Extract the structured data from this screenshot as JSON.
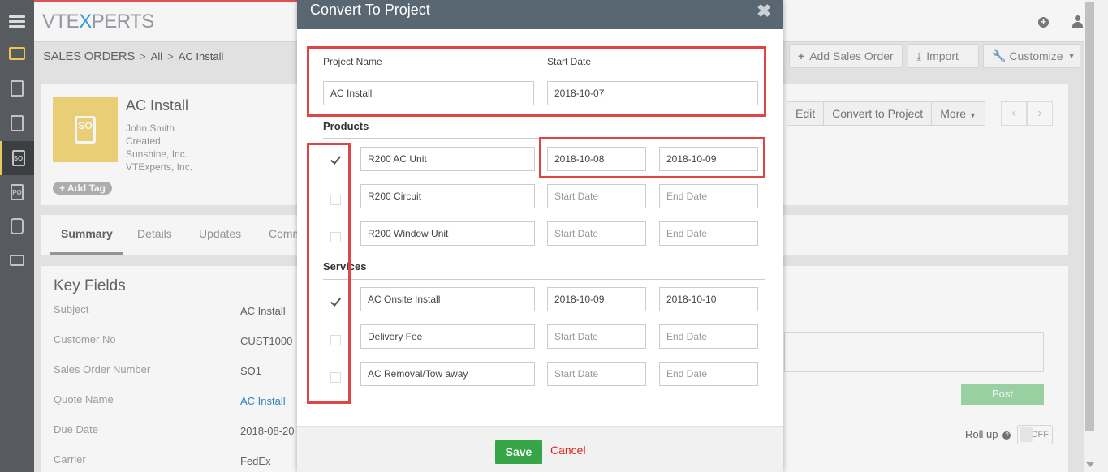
{
  "app": {
    "logo_prefix": "VTE",
    "logo_x": "X",
    "logo_suffix": "PERTS"
  },
  "header_icons": [
    "plus-circle-icon",
    "user-icon"
  ],
  "sidebar": {
    "items": [
      {
        "name": "menu",
        "icon": "hamburger-icon"
      },
      {
        "name": "sales",
        "icon": "forklift-icon"
      },
      {
        "name": "contacts",
        "icon": "contact-card-icon"
      },
      {
        "name": "invoice",
        "icon": "invoice-icon"
      },
      {
        "name": "sales-orders",
        "icon": "so-icon",
        "text": "SO"
      },
      {
        "name": "purchase-orders",
        "icon": "po-icon",
        "text": "PO"
      },
      {
        "name": "products",
        "icon": "box-icon"
      },
      {
        "name": "services",
        "icon": "service-icon"
      }
    ]
  },
  "breadcrumb": {
    "module": "SALES ORDERS",
    "sep": ">",
    "filter": "All",
    "record": "AC Install"
  },
  "header_buttons": {
    "add": "Add Sales Order",
    "import": "Import",
    "customize": "Customize"
  },
  "record": {
    "badge": "SO",
    "title": "AC Install",
    "lines": [
      "John Smith",
      "Created",
      "Sunshine, Inc.",
      "VTExperts, Inc."
    ],
    "add_tag": "Add Tag",
    "actions": {
      "edit": "Edit",
      "convert": "Convert to Project",
      "more": "More"
    },
    "prev": "‹",
    "next": "›"
  },
  "tabs": [
    "Summary",
    "Details",
    "Updates",
    "Comm"
  ],
  "key_fields": {
    "title": "Key Fields",
    "rows": [
      {
        "label": "Subject",
        "value": "AC Install"
      },
      {
        "label": "Customer No",
        "value": "CUST1000"
      },
      {
        "label": "Sales Order Number",
        "value": "SO1"
      },
      {
        "label": "Quote Name",
        "value": "AC Install"
      },
      {
        "label": "Due Date",
        "value": "2018-08-20"
      },
      {
        "label": "Carrier",
        "value": "FedEx"
      }
    ]
  },
  "comments": {
    "post": "Post",
    "rollup": "Roll up",
    "toggle": "OFF"
  },
  "modal": {
    "title": "Convert To Project",
    "close": "✖",
    "project_name_label": "Project Name",
    "start_date_label": "Start Date",
    "project_name": "AC Install",
    "start_date": "2018-10-07",
    "products_label": "Products",
    "services_label": "Services",
    "placeholders": {
      "start": "Start Date",
      "end": "End Date"
    },
    "products": [
      {
        "name": "R200 AC Unit",
        "checked": true,
        "start": "2018-10-08",
        "end": "2018-10-09"
      },
      {
        "name": "R200 Circuit",
        "checked": false,
        "start": "",
        "end": ""
      },
      {
        "name": "R200 Window Unit",
        "checked": false,
        "start": "",
        "end": ""
      }
    ],
    "services": [
      {
        "name": "AC Onsite Install",
        "checked": true,
        "start": "2018-10-09",
        "end": "2018-10-10"
      },
      {
        "name": "Delivery Fee",
        "checked": false,
        "start": "",
        "end": ""
      },
      {
        "name": "AC Removal/Tow away",
        "checked": false,
        "start": "",
        "end": ""
      }
    ],
    "save": "Save",
    "cancel": "Cancel"
  },
  "colors": {
    "accent": "#2fa4dc",
    "modal_header": "#596773",
    "save": "#35a548",
    "cancel": "#e2231a",
    "highlight": "#e04545",
    "so_badge": "#f3d77b"
  }
}
